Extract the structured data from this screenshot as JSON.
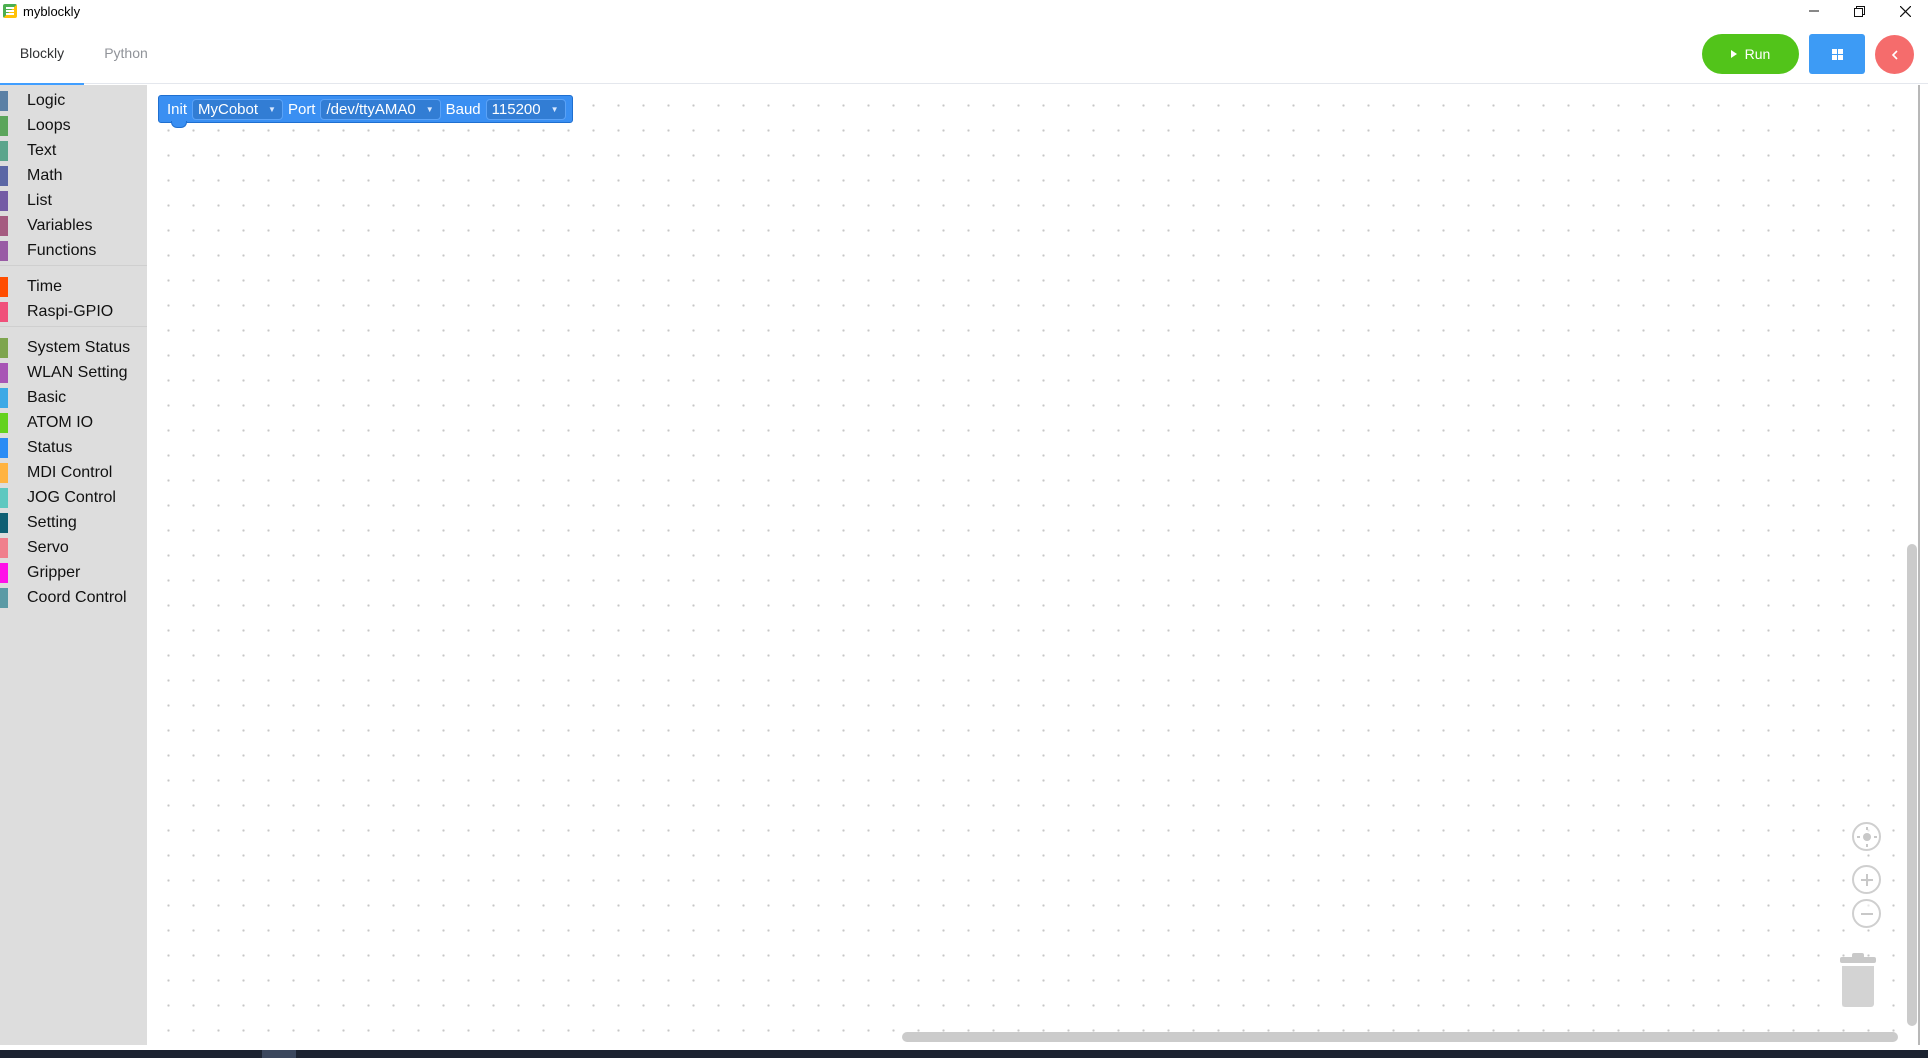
{
  "window": {
    "title": "myblockly",
    "controls": [
      "minimize",
      "restore",
      "close"
    ]
  },
  "tabs": [
    {
      "label": "Blockly",
      "active": true
    },
    {
      "label": "Python",
      "active": false
    }
  ],
  "toolbar": {
    "run_label": "Run",
    "run_color": "#52c41a",
    "grid_color": "#3d9bf5",
    "back_color": "#f56c6c"
  },
  "toolbox": {
    "groups": [
      [
        {
          "label": "Logic",
          "color": "#5b80a5"
        },
        {
          "label": "Loops",
          "color": "#5ba55b"
        },
        {
          "label": "Text",
          "color": "#5ba58c"
        },
        {
          "label": "Math",
          "color": "#5b67a5"
        },
        {
          "label": "List",
          "color": "#745ba5"
        },
        {
          "label": "Variables",
          "color": "#a55b80"
        },
        {
          "label": "Functions",
          "color": "#995ba5"
        }
      ],
      [
        {
          "label": "Time",
          "color": "#ff4d00"
        },
        {
          "label": "Raspi-GPIO",
          "color": "#f0507a"
        }
      ],
      [
        {
          "label": "System Status",
          "color": "#7ea54e"
        },
        {
          "label": "WLAN Setting",
          "color": "#a855b5"
        },
        {
          "label": "Basic",
          "color": "#3ca9e6"
        },
        {
          "label": "ATOM IO",
          "color": "#63d21e"
        },
        {
          "label": "Status",
          "color": "#2a8cf5"
        },
        {
          "label": "MDI Control",
          "color": "#ffb340"
        },
        {
          "label": "JOG Control",
          "color": "#5ec8c0"
        },
        {
          "label": "Setting",
          "color": "#0f5f73"
        },
        {
          "label": "Servo",
          "color": "#f07f8c"
        },
        {
          "label": "Gripper",
          "color": "#ff10e8"
        },
        {
          "label": "Coord Control",
          "color": "#5b9aa5"
        }
      ]
    ]
  },
  "block": {
    "init_label": "Init",
    "robot": "MyCobot",
    "port_label": "Port",
    "port": "/dev/ttyAMA0",
    "baud_label": "Baud",
    "baud": "115200",
    "color": "#3a8ff2"
  },
  "workspace_controls": [
    "recenter-icon",
    "zoom-in-icon",
    "zoom-out-icon",
    "trash-icon"
  ]
}
